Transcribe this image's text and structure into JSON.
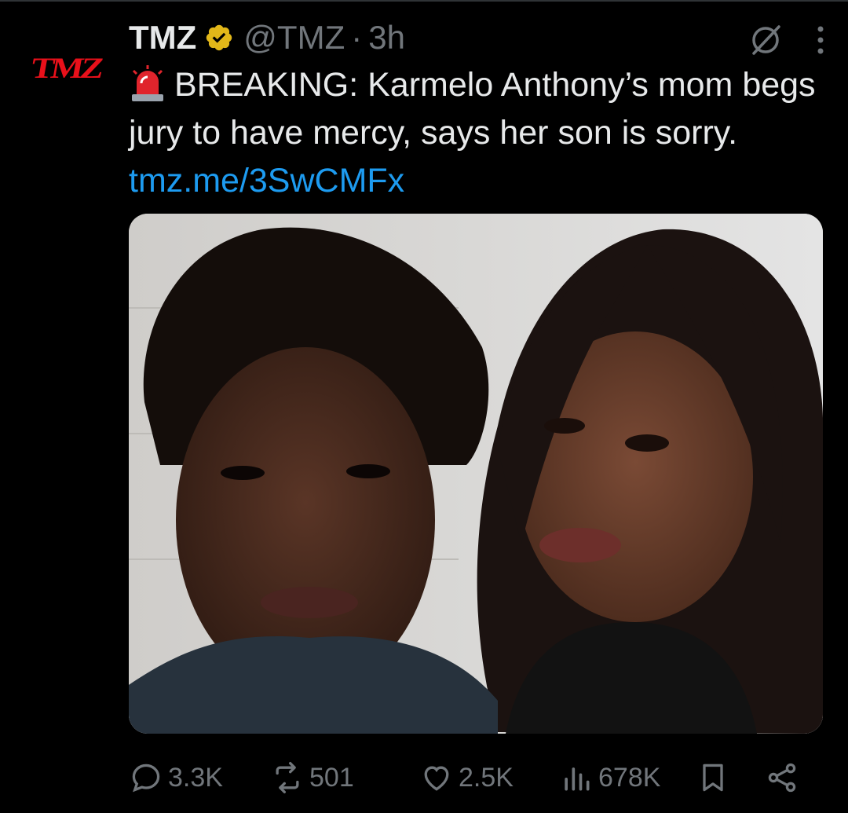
{
  "account": {
    "avatar_logo": "TMZ",
    "display_name": "TMZ",
    "handle": "@TMZ",
    "separator": "·",
    "time": "3h",
    "verified_badge": "gold-check-badge"
  },
  "tweet": {
    "siren_icon": "police-light-emoji",
    "text": "BREAKING: Karmelo Anthony’s mom begs jury to have mercy, says her son is sorry.",
    "link": "tmz.me/3SwCMFx"
  },
  "media": {
    "description": "photo"
  },
  "actions": {
    "replies": "3.3K",
    "reposts": "501",
    "likes": "2.5K",
    "views": "678K"
  },
  "colors": {
    "background": "#000000",
    "text": "#e7e9ea",
    "muted": "#71767b",
    "link": "#1d9bf0",
    "brand": "#e8101a",
    "verified": "#e2b719"
  }
}
